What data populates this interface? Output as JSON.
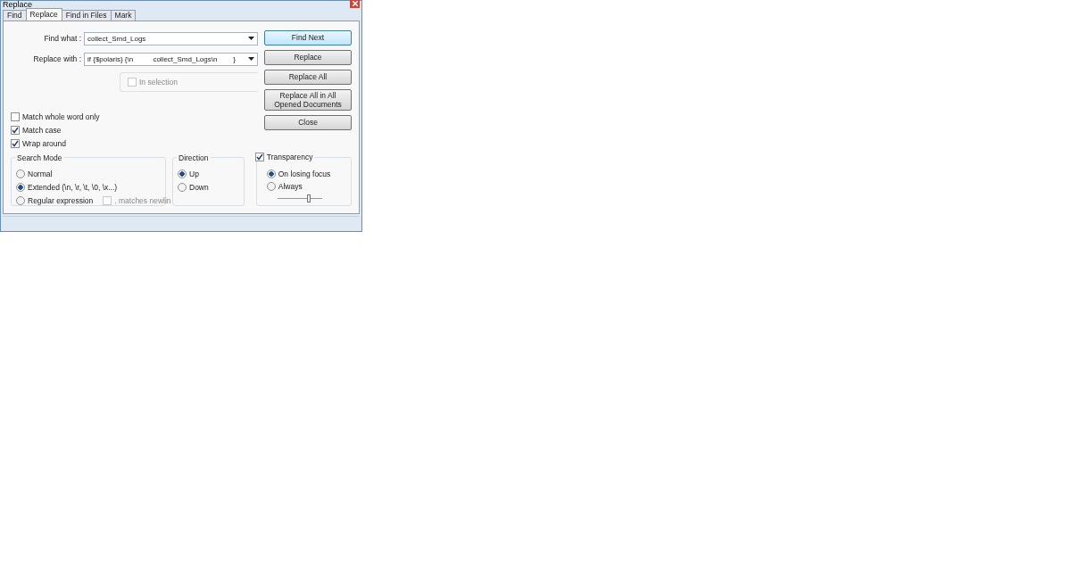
{
  "window": {
    "title": "Replace"
  },
  "tabs": [
    {
      "label": "Find",
      "selected": false
    },
    {
      "label": "Replace",
      "selected": true
    },
    {
      "label": "Find in Files",
      "selected": false
    },
    {
      "label": "Mark",
      "selected": false
    }
  ],
  "fields": [
    {
      "label": "Find what :",
      "value": "collect_Smd_Logs"
    },
    {
      "label": "Replace with :",
      "value": "if {$polaris} {\\n          collect_Smd_Logs\\n        }"
    }
  ],
  "in_selection": {
    "label": "In selection",
    "checked": false,
    "disabled": true
  },
  "buttons": [
    {
      "label": "Find Next",
      "selected": true
    },
    {
      "label": "Replace",
      "selected": false
    },
    {
      "label": "Replace All",
      "selected": false
    },
    {
      "label": "Replace All in All Opened Documents",
      "selected": false
    },
    {
      "label": "Close",
      "selected": false
    }
  ],
  "options": [
    {
      "label": "Match whole word only",
      "checked": false
    },
    {
      "label": "Match case",
      "checked": true
    },
    {
      "label": "Wrap around",
      "checked": true
    }
  ],
  "search_mode": {
    "title": "Search Mode",
    "items": [
      {
        "label": "Normal",
        "selected": false
      },
      {
        "label": "Extended (\\n, \\r, \\t, \\0, \\x...)",
        "selected": true
      },
      {
        "label": "Regular expression",
        "selected": false
      }
    ],
    "matches_newline": {
      "label": ". matches newlin",
      "checked": false,
      "disabled": true
    }
  },
  "direction": {
    "title": "Direction",
    "items": [
      {
        "label": "Up",
        "selected": true
      },
      {
        "label": "Down",
        "selected": false
      }
    ]
  },
  "transparency": {
    "label": "Transparency",
    "checked": true,
    "items": [
      {
        "label": "On losing focus",
        "selected": true
      },
      {
        "label": "Always",
        "selected": false
      }
    ],
    "level": 0.7
  }
}
